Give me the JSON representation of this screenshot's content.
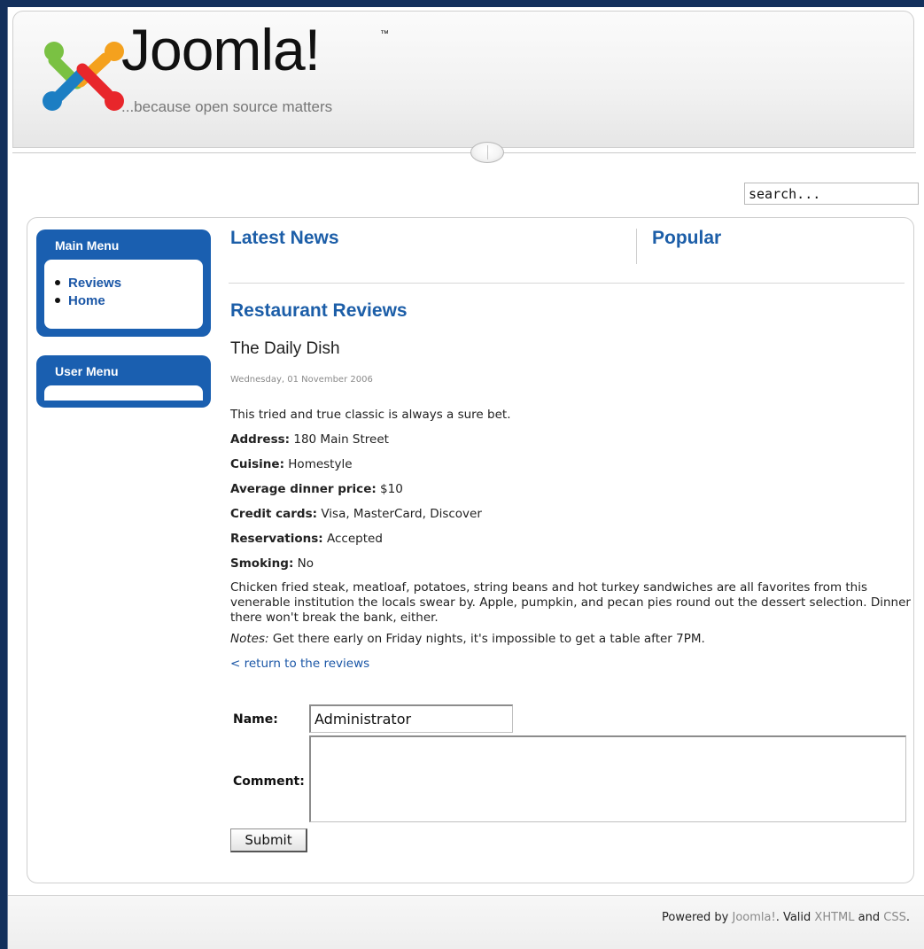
{
  "header": {
    "logo_word": "Joomla!",
    "logo_tm": "™",
    "tagline": "...because open source matters"
  },
  "search": {
    "placeholder": "search..."
  },
  "modules": {
    "main_menu": {
      "title": "Main Menu",
      "items": [
        {
          "label": "Reviews"
        },
        {
          "label": "Home"
        }
      ]
    },
    "user_menu": {
      "title": "User Menu"
    }
  },
  "top": {
    "latest_news": "Latest News",
    "popular": "Popular"
  },
  "article": {
    "category": "Restaurant Reviews",
    "title": "The Daily Dish",
    "date": "Wednesday, 01 November 2006",
    "intro": "This tried and true classic is always a sure bet.",
    "fields": [
      {
        "label": "Address:",
        "value": "180 Main Street"
      },
      {
        "label": "Cuisine:",
        "value": "Homestyle"
      },
      {
        "label": "Average dinner price:",
        "value": "$10"
      },
      {
        "label": "Credit cards:",
        "value": "Visa, MasterCard, Discover"
      },
      {
        "label": "Reservations:",
        "value": "Accepted"
      },
      {
        "label": "Smoking:",
        "value": "No"
      }
    ],
    "description": "Chicken fried steak, meatloaf, potatoes, string beans and hot turkey sandwiches are all favorites from this venerable institution the locals swear by. Apple, pumpkin, and pecan pies round out the dessert selection. Dinner there won't break the bank, either.",
    "notes_label": "Notes:",
    "notes_text": "Get there early on Friday nights, it's impossible to get a table after 7PM.",
    "return_link": "< return to the reviews"
  },
  "comment_form": {
    "name_label": "Name:",
    "name_value": "Administrator",
    "comment_label": "Comment:",
    "comment_value": "",
    "submit_label": "Submit"
  },
  "footer": {
    "powered_by": "Powered by",
    "joomla_link": "Joomla!",
    "period_valid": ". Valid",
    "xhtml_link": "XHTML",
    "and": "and",
    "css_link": "CSS",
    "end": "."
  },
  "colors": {
    "accent": "#1c5ea8",
    "module_bg": "#1a5fb0",
    "page_border": "#13305c",
    "logo_red": "#e8262b",
    "logo_green": "#7ac143",
    "logo_orange": "#f4a11e",
    "logo_blue": "#1c7ec3"
  },
  "icons": {
    "logo": "joomla-logo-icon",
    "divider": "divider-knob-icon",
    "bullet": "bullet-icon"
  }
}
